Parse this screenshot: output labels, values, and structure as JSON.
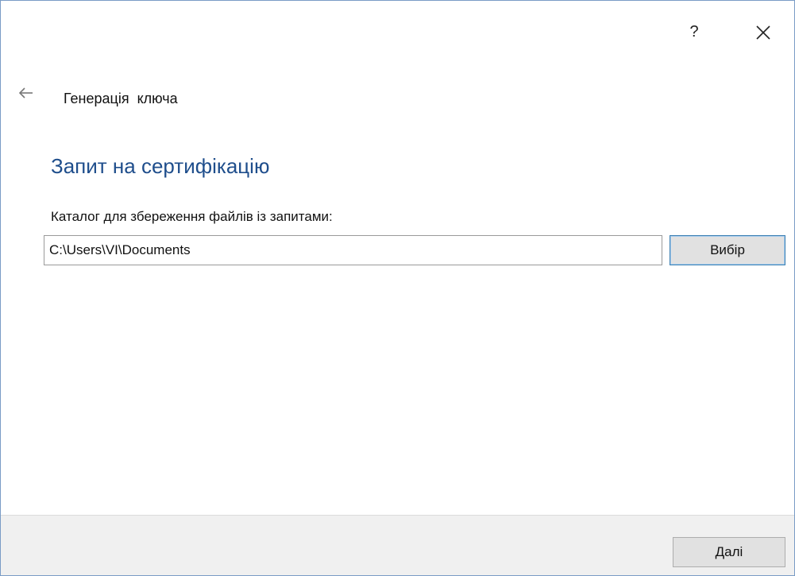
{
  "title_bar": {
    "help_label": "?",
    "help_icon": "question-mark-icon",
    "close_icon": "close-icon"
  },
  "header": {
    "back_icon": "back-arrow-icon",
    "wizard_title": "Генерація  ключа"
  },
  "main": {
    "heading": "Запит на сертифікацію",
    "directory_label": "Каталог для збереження файлів із запитами:",
    "directory_value": "C:\\Users\\VI\\Documents",
    "browse_button": "Вибір"
  },
  "footer": {
    "next_button": "Далі"
  },
  "colors": {
    "heading": "#1f4e8c",
    "footer_bg": "#f0f0f0",
    "button_bg": "#e1e1e1",
    "focus_border": "#3c7fb1"
  }
}
